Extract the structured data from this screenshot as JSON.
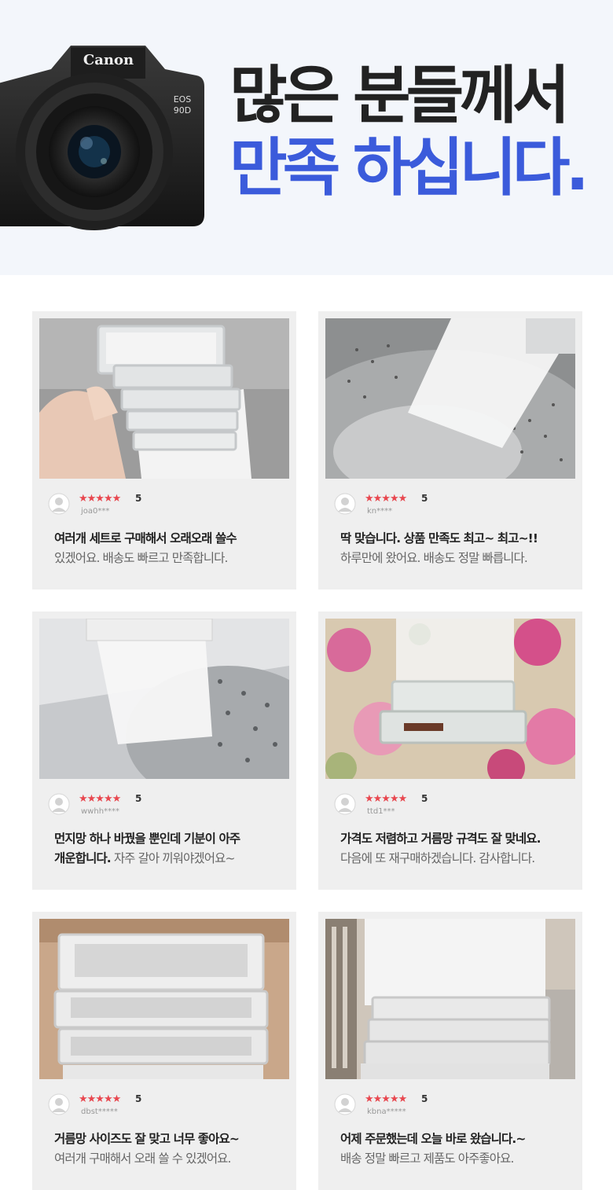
{
  "hero": {
    "camera_brand": "Canon",
    "camera_model": "EOS 90D",
    "headline_line1": "많은 분들께서",
    "headline_line2": "만족 하십니다.",
    "colors": {
      "background": "#f3f6fb",
      "accent": "#3b5bdb",
      "dark": "#222222"
    }
  },
  "reviews": [
    {
      "stars": "★★★★★",
      "score": "5",
      "user": "joa0***",
      "line1_strong": "여러개 세트로 구매해서 오래오래 쓸수",
      "line1_light": "",
      "line2_strong": "",
      "line2_light": "있겠어요. 배송도 빠르고 만족합니다.",
      "photo": "filter-held-in-hand"
    },
    {
      "stars": "★★★★★",
      "score": "5",
      "user": "kn****",
      "line1_strong": "딱 맞습니다. 상품 만족도 최고~ 최고~!!",
      "line1_light": "",
      "line2_strong": "",
      "line2_light": "하루만에 왔어요. 배송도 정말 빠릅니다.",
      "photo": "filter-in-washer-drum"
    },
    {
      "stars": "★★★★★",
      "score": "5",
      "user": "wwhh****",
      "line1_strong": "먼지망 하나 바꿨을 뿐인데 기분이 아주",
      "line1_light": "",
      "line2_strong": "개운합니다.",
      "line2_light": " 자주 갈아 끼워야겠어요~",
      "photo": "filter-in-washer-tub"
    },
    {
      "stars": "★★★★★",
      "score": "5",
      "user": "ttd1***",
      "line1_strong": "가격도 저렴하고 거름망 규격도 잘 맞네요.",
      "line1_light": "",
      "line2_strong": "",
      "line2_light": "다음에 또 재구매하겠습니다. 감사합니다.",
      "photo": "filter-on-floral-fabric"
    },
    {
      "stars": "★★★★★",
      "score": "5",
      "user": "dbst*****",
      "line1_strong": "거름망 사이즈도 잘 맞고 너무 좋아요~",
      "line1_light": "",
      "line2_strong": "",
      "line2_light": "여러개 구매해서 오래 쓸 수 있겠어요.",
      "photo": "filter-stack-in-box"
    },
    {
      "stars": "★★★★★",
      "score": "5",
      "user": "kbna*****",
      "line1_strong": "어제 주문했는데 오늘 바로 왔습니다.~",
      "line1_light": "",
      "line2_strong": "",
      "line2_light": "배송 정말 빠르고 제품도 아주좋아요.",
      "photo": "filter-stack-closeup"
    }
  ]
}
